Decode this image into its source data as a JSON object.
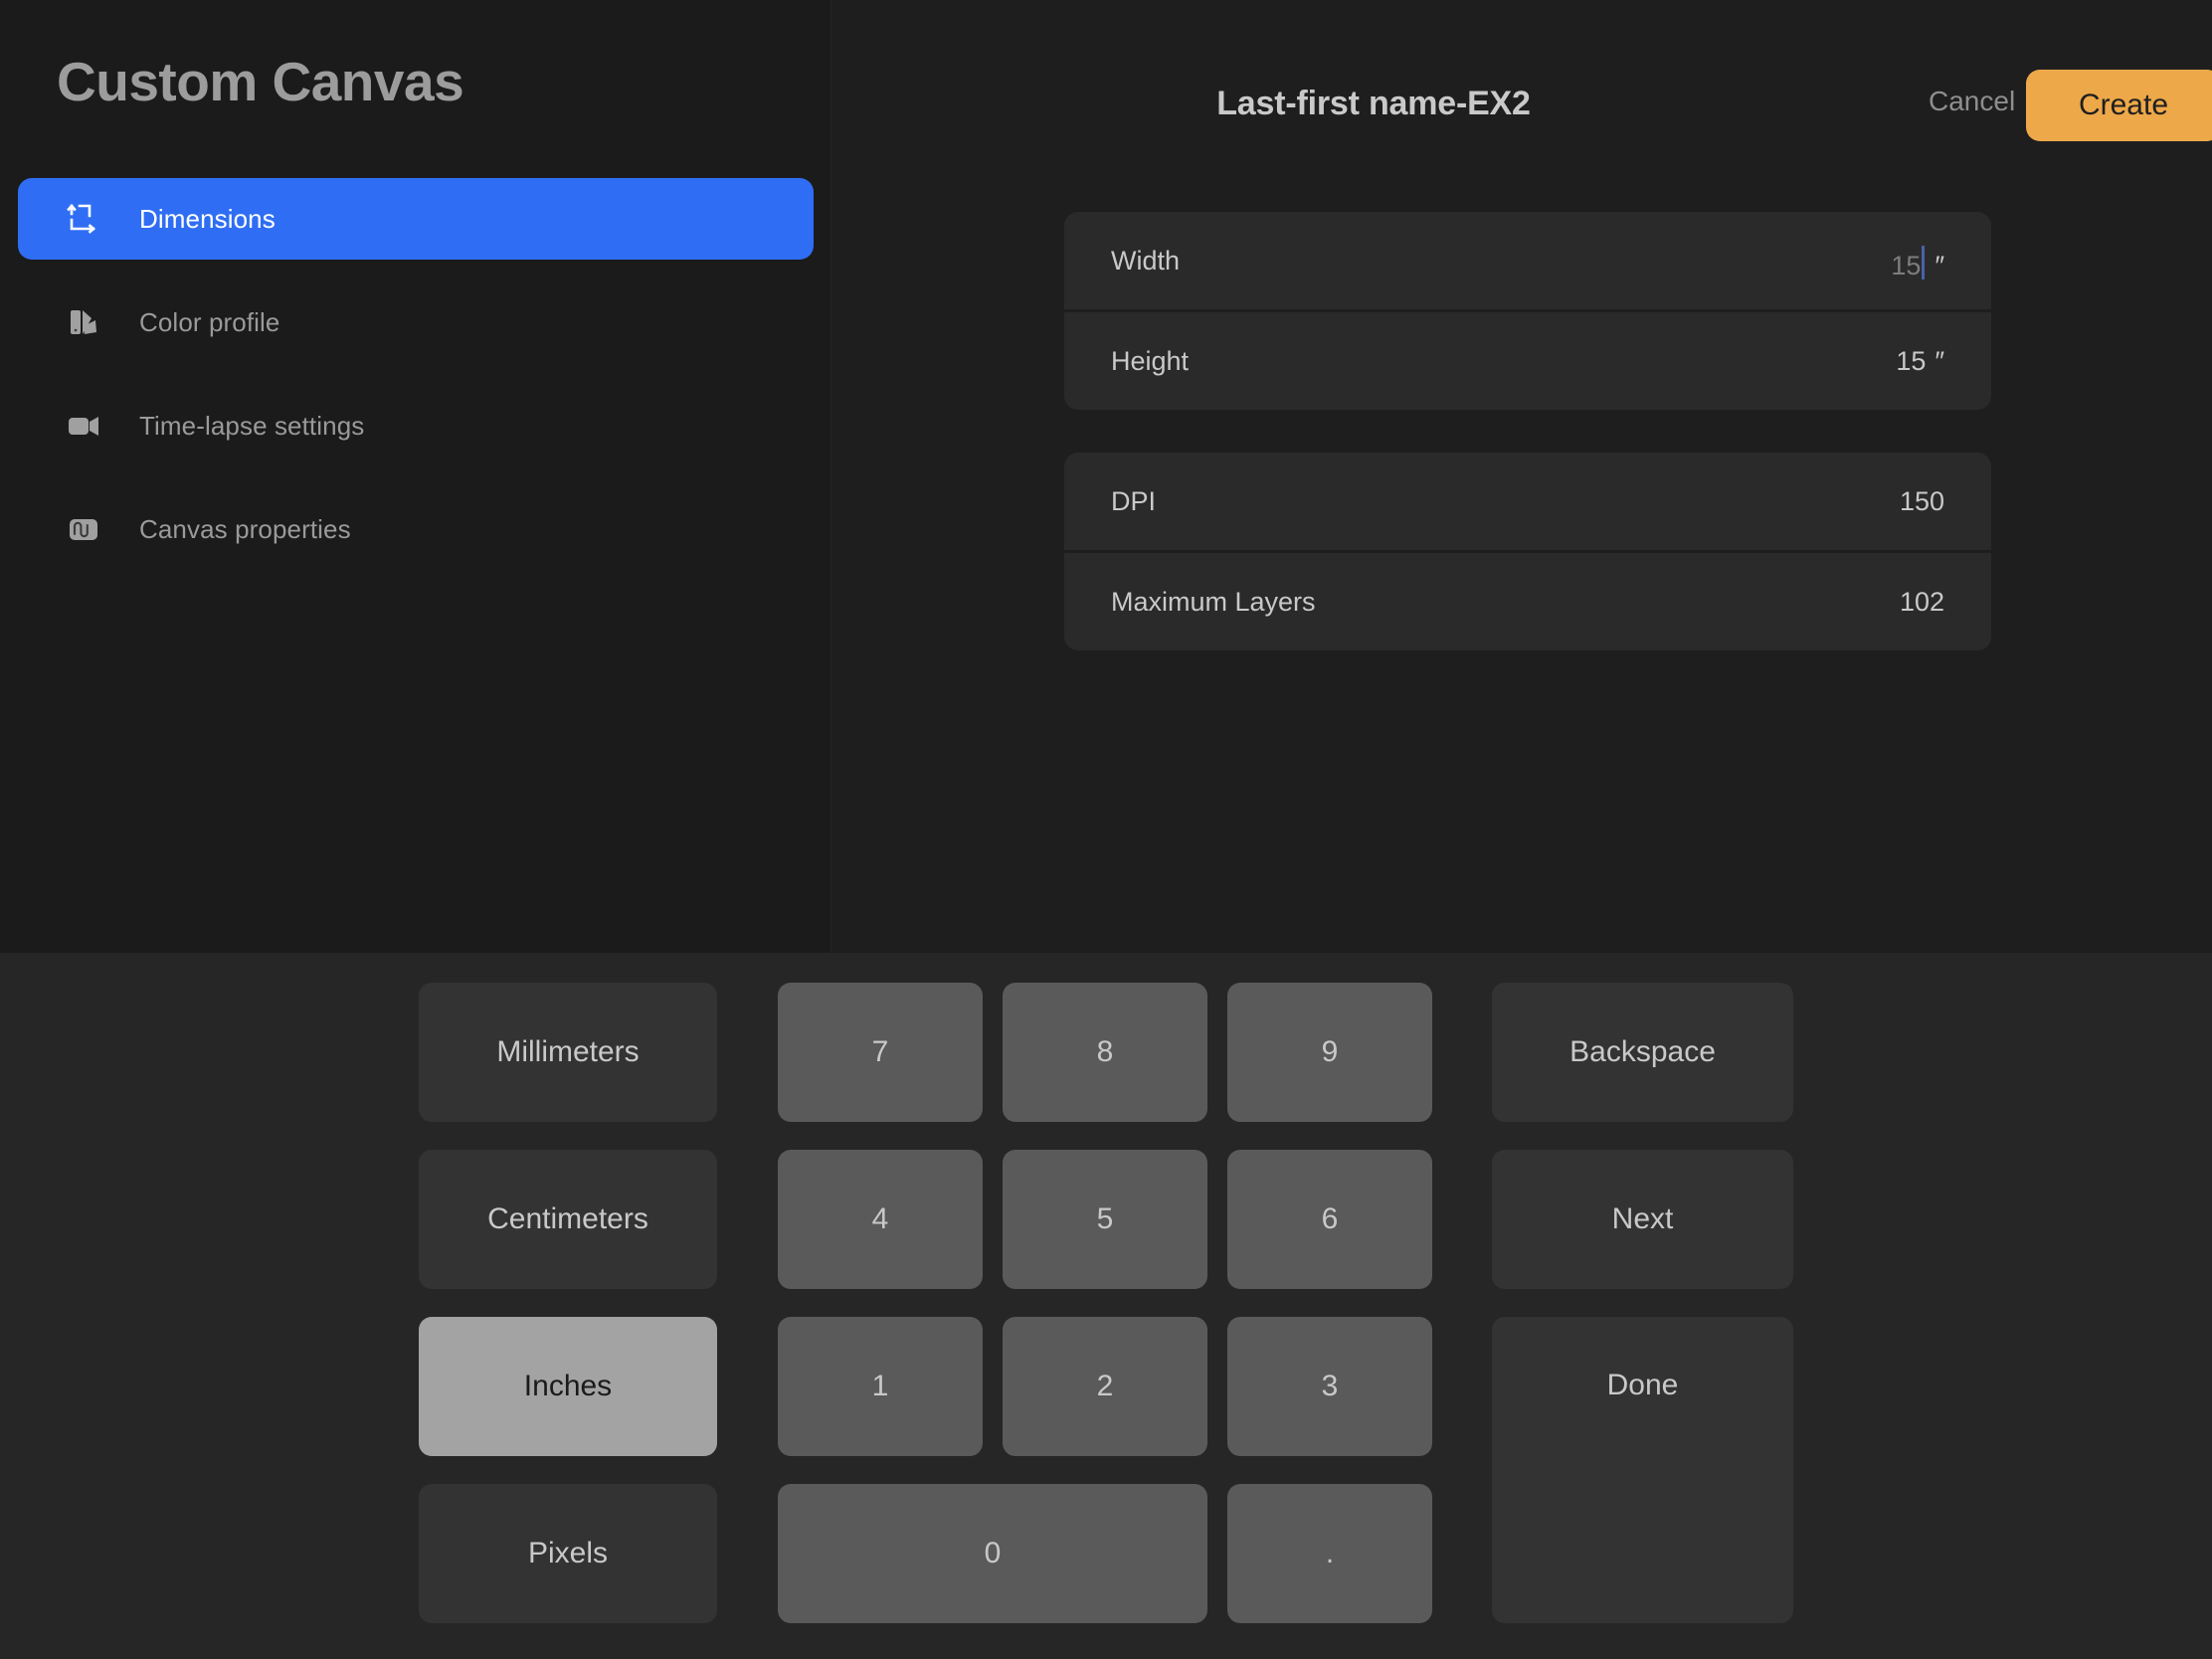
{
  "app": {
    "title": "Custom Canvas"
  },
  "sidebar": {
    "items": [
      {
        "label": "Dimensions",
        "icon": "resize-icon",
        "active": true
      },
      {
        "label": "Color profile",
        "icon": "color-swatch-icon",
        "active": false
      },
      {
        "label": "Time-lapse settings",
        "icon": "video-camera-icon",
        "active": false
      },
      {
        "label": "Canvas properties",
        "icon": "canvas-properties-icon",
        "active": false
      }
    ]
  },
  "header": {
    "document_title": "Last-first name-EX2",
    "cancel_label": "Cancel",
    "create_label": "Create"
  },
  "dimensions": {
    "groups": [
      {
        "rows": [
          {
            "label": "Width",
            "value": "15",
            "unit": "″",
            "focused": true
          },
          {
            "label": "Height",
            "value": "15",
            "unit": "″",
            "focused": false
          }
        ]
      },
      {
        "rows": [
          {
            "label": "DPI",
            "value": "150",
            "unit": "",
            "focused": false
          },
          {
            "label": "Maximum Layers",
            "value": "102",
            "unit": "",
            "focused": false
          }
        ]
      }
    ]
  },
  "keyboard": {
    "units": [
      {
        "label": "Millimeters",
        "selected": false
      },
      {
        "label": "Centimeters",
        "selected": false
      },
      {
        "label": "Inches",
        "selected": true
      },
      {
        "label": "Pixels",
        "selected": false
      }
    ],
    "numbers": [
      "7",
      "8",
      "9",
      "4",
      "5",
      "6",
      "1",
      "2",
      "3"
    ],
    "zero_label": "0",
    "decimal_label": ".",
    "actions": [
      {
        "label": "Backspace"
      },
      {
        "label": "Next"
      },
      {
        "label": "Done"
      }
    ]
  },
  "colors": {
    "accent_blue": "#2f6ef4",
    "accent_orange": "#eda849",
    "caret_blue": "#4a62a8",
    "panel_bg": "#1e1e1e",
    "sidebar_bg": "#1b1b1b",
    "keyboard_bg": "#262626"
  }
}
